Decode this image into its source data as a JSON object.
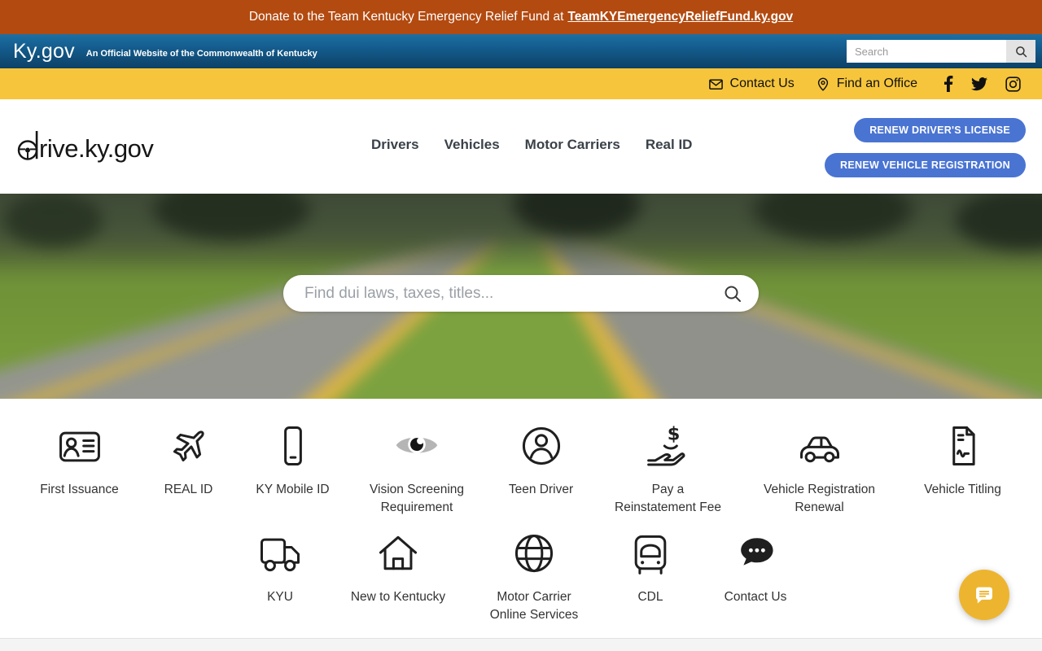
{
  "banner": {
    "prefix": "Donate to the Team Kentucky Emergency Relief Fund at",
    "link_text": "TeamKYEmergencyReliefFund.ky.gov"
  },
  "gov_bar": {
    "logo": "Ky.gov",
    "tagline": "An Official Website of the Commonwealth of Kentucky",
    "search_placeholder": "Search"
  },
  "utility_bar": {
    "contact_label": "Contact Us",
    "find_office_label": "Find an Office",
    "social_icons": [
      "facebook-icon",
      "twitter-icon",
      "instagram-icon"
    ]
  },
  "header": {
    "logo_text": "rive.ky.gov",
    "logo_full": "drive.ky.gov",
    "nav": [
      {
        "label": "Drivers"
      },
      {
        "label": "Vehicles"
      },
      {
        "label": "Motor Carriers"
      },
      {
        "label": "Real ID"
      }
    ],
    "renew_license_label": "RENEW DRIVER'S LICENSE",
    "renew_registration_label": "RENEW VEHICLE REGISTRATION"
  },
  "hero": {
    "search_placeholder": "Find dui laws, taxes, titles...",
    "background_description": "blurred divided highway with grass median and trees"
  },
  "quick_links": {
    "row1": [
      {
        "label": "First Issuance",
        "icon": "id-card-icon"
      },
      {
        "label": "REAL ID",
        "icon": "airplane-icon"
      },
      {
        "label": "KY Mobile ID",
        "icon": "smartphone-icon"
      },
      {
        "label": "Vision Screening\nRequirement",
        "icon": "eye-icon"
      },
      {
        "label": "Teen Driver",
        "icon": "person-circle-icon"
      },
      {
        "label": "Pay a\nReinstatement Fee",
        "icon": "hand-dollar-icon"
      },
      {
        "label": "Vehicle Registration\nRenewal",
        "icon": "car-icon"
      },
      {
        "label": "Vehicle Titling",
        "icon": "title-document-icon"
      }
    ],
    "row2": [
      {
        "label": "KYU",
        "icon": "delivery-truck-icon"
      },
      {
        "label": "New to Kentucky",
        "icon": "house-icon"
      },
      {
        "label": "Motor Carrier\nOnline Services",
        "icon": "globe-icon"
      },
      {
        "label": "CDL",
        "icon": "truck-front-icon"
      },
      {
        "label": "Contact Us",
        "icon": "chat-bubble-icon"
      }
    ]
  },
  "colors": {
    "banner_orange": "#b34a10",
    "gov_blue": "#135a8a",
    "utility_yellow": "#f6c53c",
    "button_blue": "#4a74d2",
    "chat_fab_yellow": "#edb52f"
  }
}
